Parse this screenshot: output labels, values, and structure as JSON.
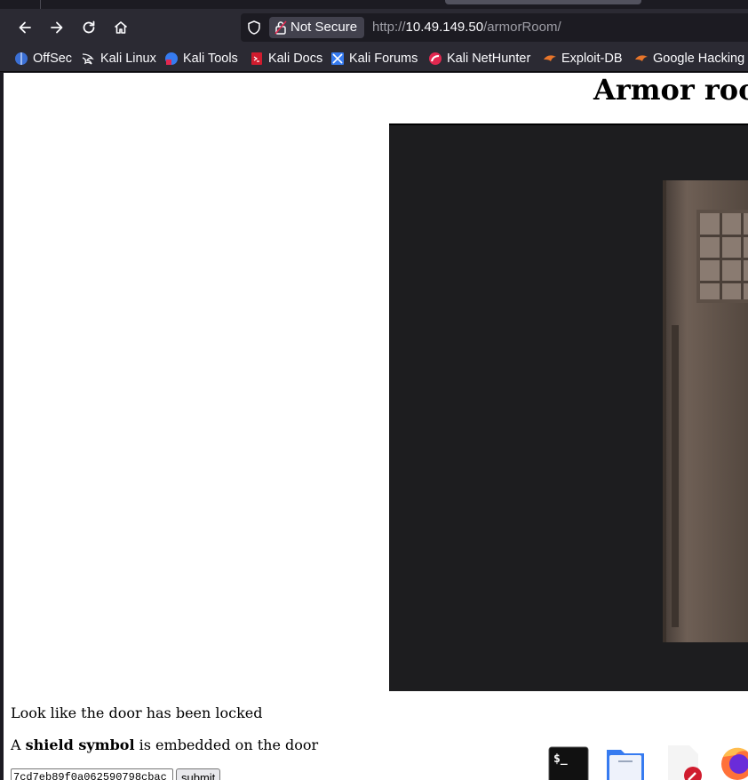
{
  "browser": {
    "url_prefix": "http://",
    "url_host": "10.49.149.50",
    "url_path": "/armorRoom/",
    "security_label": "Not Secure"
  },
  "bookmarks": [
    {
      "label": "OffSec",
      "icon": "offsec-icon"
    },
    {
      "label": "Kali Linux",
      "icon": "kali-dragon-icon"
    },
    {
      "label": "Kali Tools",
      "icon": "kali-tools-icon"
    },
    {
      "label": "Kali Docs",
      "icon": "kali-docs-icon"
    },
    {
      "label": "Kali Forums",
      "icon": "kali-forums-icon"
    },
    {
      "label": "Kali NetHunter",
      "icon": "nethunter-icon"
    },
    {
      "label": "Exploit-DB",
      "icon": "exploit-db-icon"
    },
    {
      "label": "Google Hacking DB",
      "icon": "ghdb-icon"
    }
  ],
  "page": {
    "title": "Armor room",
    "message_locked": "Look like the door has been locked",
    "message_symbol_prefix": "A ",
    "message_symbol_bold": "shield symbol",
    "message_symbol_suffix": " is embedded on the door",
    "input_value": "7cd7eb89f0a062590798cbac",
    "submit_label": "submit"
  },
  "dock": [
    "terminal-icon",
    "file-manager-icon",
    "text-editor-icon",
    "firefox-icon"
  ],
  "colors": {
    "browser_chrome": "#2b2a33",
    "url_field": "#1c1b22",
    "page_background": "#ffffff"
  }
}
